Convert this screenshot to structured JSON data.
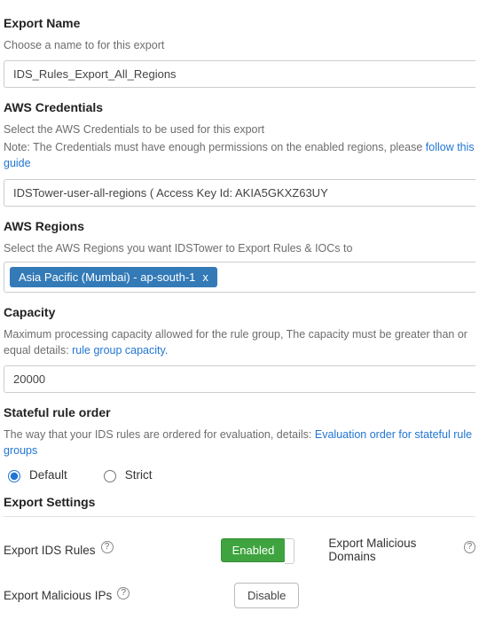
{
  "export_name": {
    "title": "Export Name",
    "hint": "Choose a name to for this export",
    "value": "IDS_Rules_Export_All_Regions"
  },
  "aws_credentials": {
    "title": "AWS Credentials",
    "hint1": "Select the AWS Credentials to be used for this export",
    "hint2_prefix": "Note: The Credentials must have enough permissions on the enabled regions, please ",
    "hint2_link": "follow this guide",
    "value": "IDSTower-user-all-regions ( Access Key Id: AKIA5GKXZ63UY"
  },
  "aws_regions": {
    "title": "AWS Regions",
    "hint": "Select the AWS Regions you want IDSTower to Export Rules & IOCs to",
    "chips": [
      {
        "label": "Asia Pacific (Mumbai) - ap-south-1"
      }
    ]
  },
  "capacity": {
    "title": "Capacity",
    "hint_prefix": "Maximum processing capacity allowed for the rule group, The capacity must be greater than or equal details: ",
    "hint_link": "rule group capacity.",
    "value": "20000"
  },
  "rule_order": {
    "title": "Stateful rule order",
    "hint_prefix": "The way that your IDS rules are ordered for evaluation, details: ",
    "hint_link": "Evaluation order for stateful rule groups",
    "options": {
      "default": "Default",
      "strict": "Strict"
    },
    "selected": "default"
  },
  "export_settings": {
    "title": "Export Settings",
    "ids_rules": {
      "label": "Export IDS Rules",
      "state_label": "Enabled"
    },
    "malicious_domains": {
      "label": "Export Malicious Domains"
    },
    "malicious_ips": {
      "label": "Export Malicious IPs",
      "state_label": "Disable"
    }
  }
}
